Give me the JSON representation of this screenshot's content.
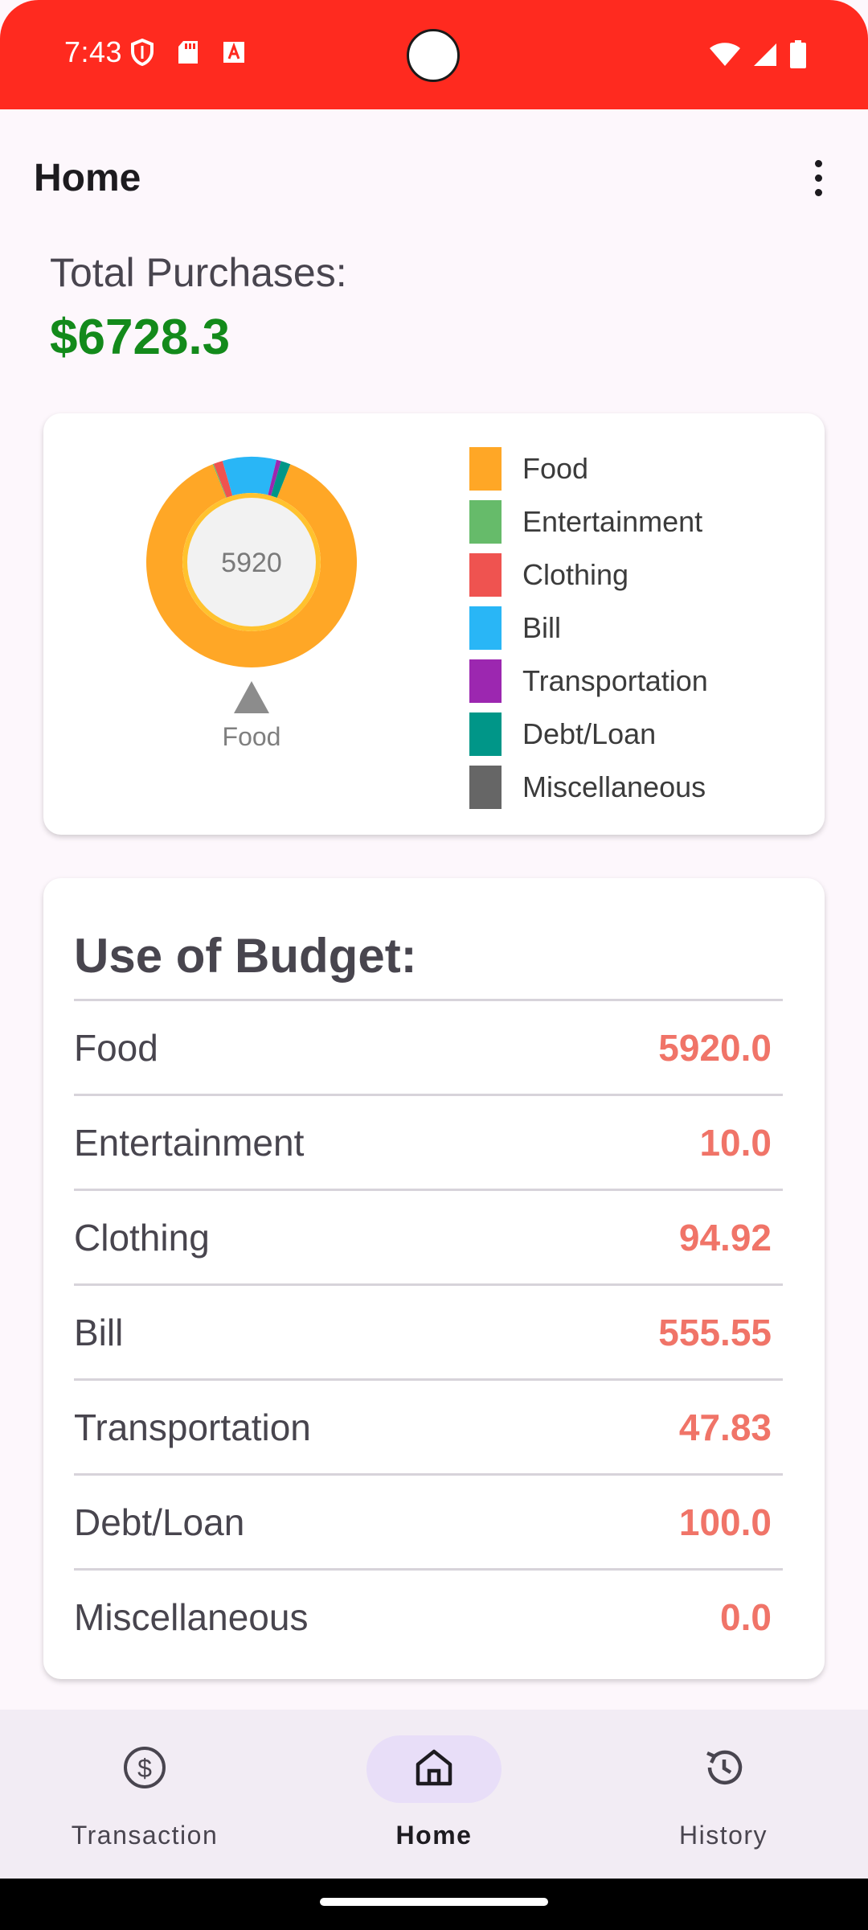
{
  "status_bar": {
    "time": "7:43",
    "left_icons": [
      "shield-icon",
      "sd-card-icon",
      "notification-a-icon"
    ],
    "right_icons": [
      "wifi-icon",
      "signal-icon",
      "battery-icon"
    ]
  },
  "app_bar": {
    "title": "Home",
    "menu_icon": "more-vert-icon"
  },
  "summary": {
    "label": "Total Purchases:",
    "value": "$6728.3"
  },
  "chart_data": {
    "type": "pie",
    "center_label": "5920",
    "selected_label": "Food",
    "categories": [
      "Food",
      "Entertainment",
      "Clothing",
      "Bill",
      "Transportation",
      "Debt/Loan",
      "Miscellaneous"
    ],
    "values": [
      5920.0,
      10.0,
      94.92,
      555.55,
      47.83,
      100.0,
      0.0
    ],
    "colors": [
      "#ffa726",
      "#66bb6a",
      "#ef5350",
      "#29b6f6",
      "#9c27b0",
      "#009688",
      "#666666"
    ]
  },
  "budget": {
    "title": "Use of Budget:",
    "rows": [
      {
        "name": "Food",
        "value": "5920.0"
      },
      {
        "name": "Entertainment",
        "value": "10.0"
      },
      {
        "name": "Clothing",
        "value": "94.92"
      },
      {
        "name": "Bill",
        "value": "555.55"
      },
      {
        "name": "Transportation",
        "value": "47.83"
      },
      {
        "name": "Debt/Loan",
        "value": "100.0"
      },
      {
        "name": "Miscellaneous",
        "value": "0.0"
      }
    ]
  },
  "bottom_nav": {
    "active": "Home",
    "items": [
      {
        "label": "Transaction",
        "icon": "dollar-circle-icon"
      },
      {
        "label": "Home",
        "icon": "home-icon"
      },
      {
        "label": "History",
        "icon": "history-icon"
      }
    ]
  }
}
